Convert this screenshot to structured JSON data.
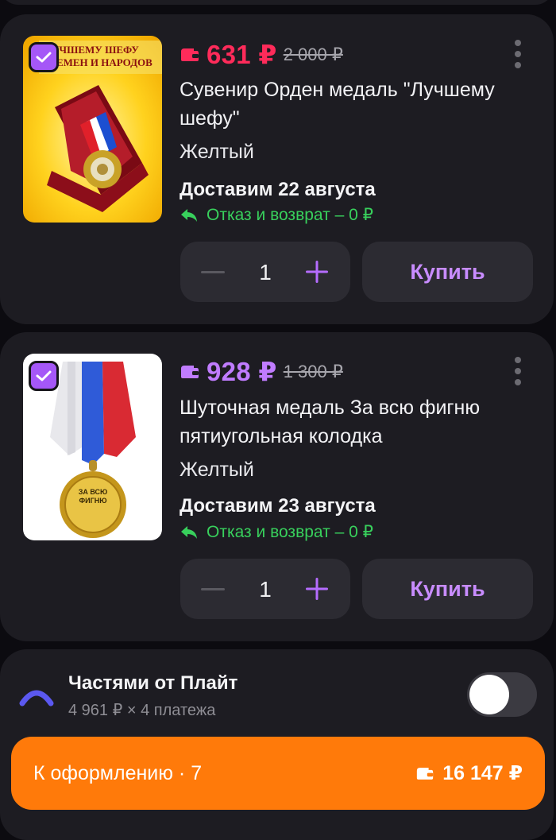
{
  "items": [
    {
      "price": "631 ₽",
      "old_price": "2 000 ₽",
      "price_color": "#ff2b5a",
      "banner_line1": "УЧШЕМУ ШЕФУ",
      "banner_line2": "РЕМЕН И НАРОДОВ",
      "title_line1": "Сувенир Орден медаль \"Лучшему",
      "title_line2": "шефу\"",
      "color": "Желтый",
      "delivery": "Доставим 22 августа",
      "returns": "Отказ и возврат – 0 ₽",
      "quantity": "1",
      "buy_label": "Купить",
      "checked": true,
      "icons": [
        "wallet-icon",
        "more-vertical-icon",
        "return-arrow-icon",
        "minus-icon",
        "plus-icon",
        "checkmark-icon"
      ]
    },
    {
      "price": "928 ₽",
      "old_price": "1 300 ₽",
      "price_color": "#c07cff",
      "medal_text": "ЗА ВСЮ ФИГНЮ",
      "title_line1": "Шуточная медаль За всю фигню",
      "title_line2": "пятиугольная колодка",
      "color": "Желтый",
      "delivery": "Доставим 23 августа",
      "returns": "Отказ и возврат – 0 ₽",
      "quantity": "1",
      "buy_label": "Купить",
      "checked": true
    }
  ],
  "installments": {
    "title": "Частями от Плайт",
    "subtitle": "4 961 ₽ × 4 платежа",
    "toggle_on": false
  },
  "checkout": {
    "label": "К оформлению · 7",
    "total": "16 147 ₽"
  },
  "colors": {
    "background": "#0c0b10",
    "card": "#1d1c22",
    "button": "#2c2b32",
    "accent_purple": "#a557f7",
    "buy_text": "#c88cff",
    "returns_green": "#38d05c",
    "checkout_orange": "#ff7a0a"
  }
}
